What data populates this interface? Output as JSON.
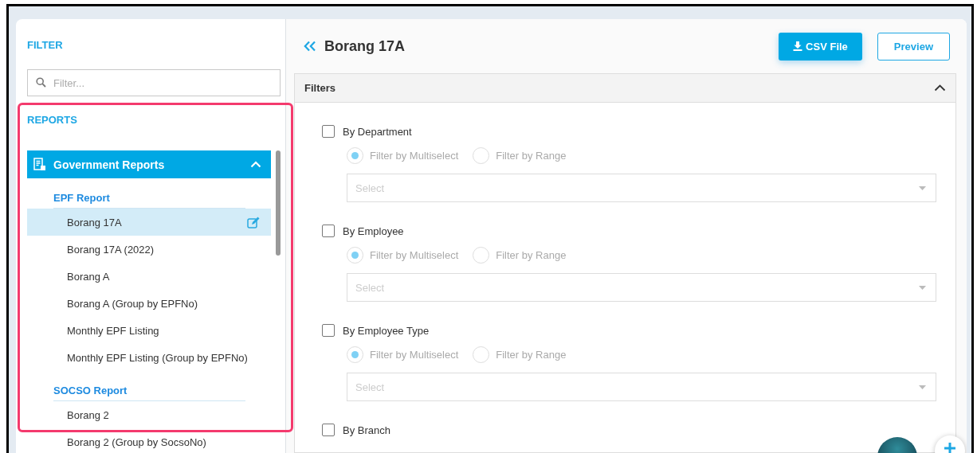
{
  "sidebar": {
    "filter_title": "FILTER",
    "search": {
      "placeholder": "Filter..."
    },
    "reports_title": "REPORTS",
    "group": {
      "label": "Government Reports",
      "expanded": true,
      "sections": [
        {
          "title": "EPF Report",
          "items": [
            {
              "label": "Borang 17A",
              "selected": true
            },
            {
              "label": "Borang 17A (2022)",
              "selected": false
            },
            {
              "label": "Borang A",
              "selected": false
            },
            {
              "label": "Borang A (Group by EPFNo)",
              "selected": false
            },
            {
              "label": "Monthly EPF Listing",
              "selected": false
            },
            {
              "label": "Monthly EPF Listing (Group by EPFNo)",
              "selected": false
            }
          ]
        },
        {
          "title": "SOCSO Report",
          "items": [
            {
              "label": "Borang 2",
              "selected": false
            },
            {
              "label": "Borang 2 (Group by SocsoNo)",
              "selected": false
            }
          ]
        }
      ]
    }
  },
  "main": {
    "title": "Borang 17A",
    "buttons": [
      {
        "label": "CSV File",
        "kind": "primary"
      },
      {
        "label": "Preview",
        "kind": "outline"
      }
    ],
    "filters": {
      "title": "Filters",
      "expanded": true,
      "groups": [
        {
          "label": "By Department",
          "checked": false,
          "options": [
            {
              "label": "Filter by Multiselect",
              "selected": true
            },
            {
              "label": "Filter by Range",
              "selected": false
            }
          ],
          "select": {
            "placeholder": "Select"
          }
        },
        {
          "label": "By Employee",
          "checked": false,
          "options": [
            {
              "label": "Filter by Multiselect",
              "selected": true
            },
            {
              "label": "Filter by Range",
              "selected": false
            }
          ],
          "select": {
            "placeholder": "Select"
          }
        },
        {
          "label": "By Employee Type",
          "checked": false,
          "options": [
            {
              "label": "Filter by Multiselect",
              "selected": true
            },
            {
              "label": "Filter by Range",
              "selected": false
            }
          ],
          "select": {
            "placeholder": "Select"
          }
        },
        {
          "label": "By Branch",
          "checked": false
        }
      ]
    }
  }
}
